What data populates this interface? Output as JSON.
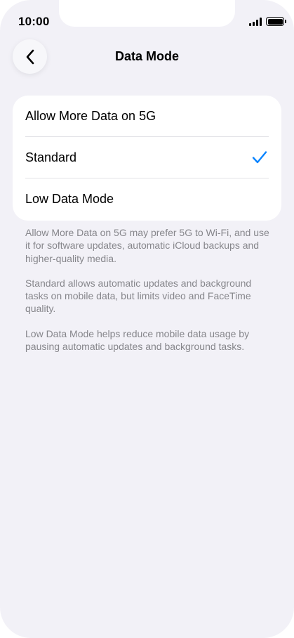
{
  "status_bar": {
    "time": "10:00",
    "icons": [
      "cellular-signal-icon",
      "battery-icon"
    ]
  },
  "nav": {
    "back_icon": "chevron-left-icon",
    "title": "Data Mode"
  },
  "options": [
    {
      "label": "Allow More Data on 5G",
      "selected": false
    },
    {
      "label": "Standard",
      "selected": true
    },
    {
      "label": "Low Data Mode",
      "selected": false
    }
  ],
  "checkmark_icon": "checkmark-icon",
  "descriptions": [
    "Allow More Data on 5G may prefer 5G to Wi-Fi, and use it for software updates, automatic iCloud backups and higher-quality media.",
    "Standard allows automatic updates and background tasks on mobile data, but limits video and FaceTime quality.",
    "Low Data Mode helps reduce mobile data usage by pausing automatic updates and background tasks."
  ],
  "colors": {
    "background": "#f2f1f7",
    "card": "#ffffff",
    "accent": "#0a84ff",
    "secondary_text": "#86868b"
  }
}
